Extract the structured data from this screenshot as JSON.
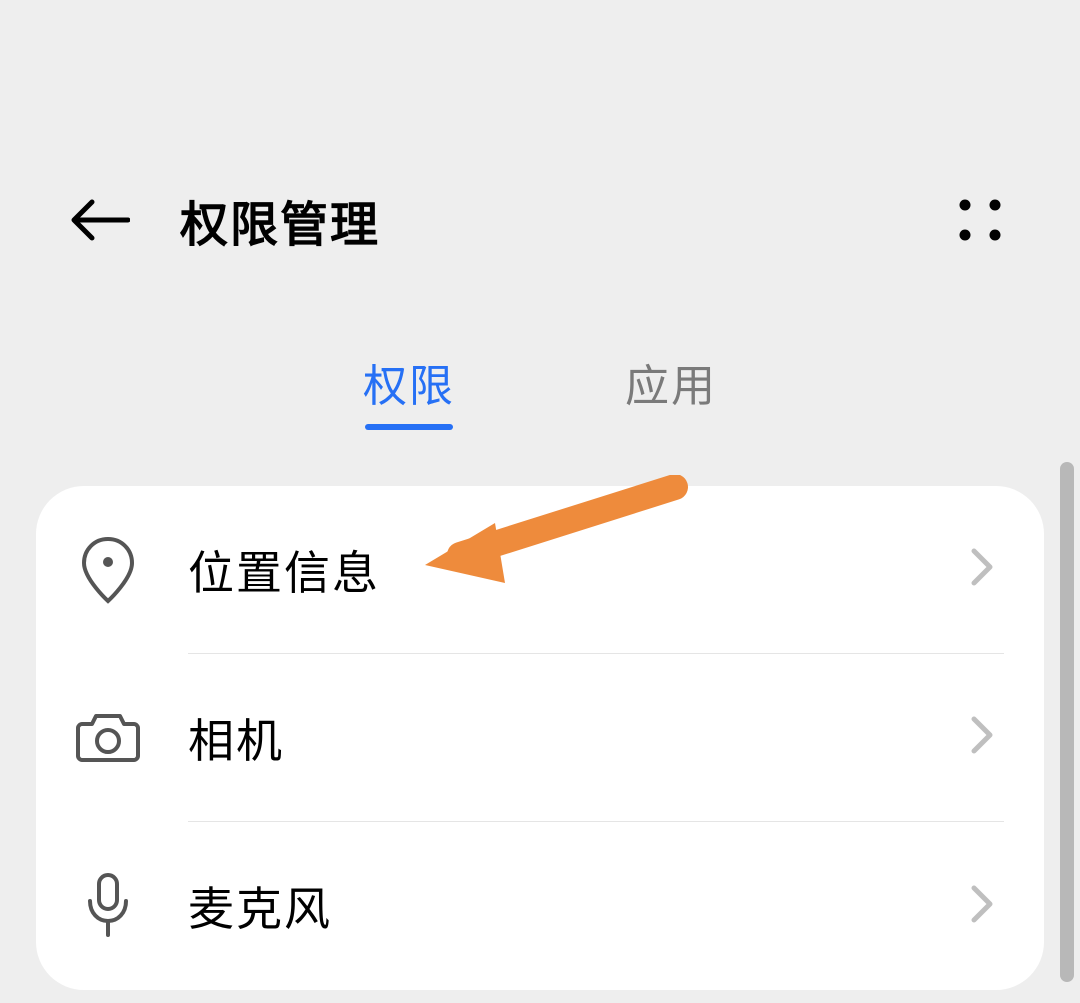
{
  "header": {
    "title": "权限管理"
  },
  "tabs": {
    "permissions": "权限",
    "applications": "应用"
  },
  "list": {
    "items": [
      {
        "label": "位置信息",
        "icon": "location"
      },
      {
        "label": "相机",
        "icon": "camera"
      },
      {
        "label": "麦克风",
        "icon": "microphone"
      }
    ]
  },
  "colors": {
    "active_tab": "#2670f5",
    "annotation_arrow": "#ee8b3c"
  }
}
